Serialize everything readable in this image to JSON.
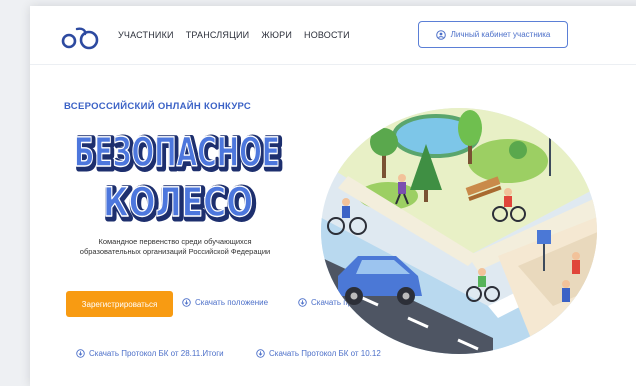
{
  "header": {
    "nav": [
      "УЧАСТНИКИ",
      "ТРАНСЛЯЦИИ",
      "ЖЮРИ",
      "НОВОСТИ"
    ],
    "account_button": "Личный кабинет участника"
  },
  "hero": {
    "eyebrow": "ВСЕРОССИЙСКИЙ ОНЛАЙН КОНКУРС",
    "title_line1": "БЕЗОПАСНОЕ",
    "title_line2": "КОЛЕСО",
    "subtitle": "Командное первенство среди обучающихся образовательных организаций Российской Федерации",
    "register_button": "Зарегистрироваться"
  },
  "links": [
    "Скачать положение",
    "Скачать приказ об",
    "Скачать Протокол БК от 28.11.Итоги",
    "Скачать Протокол БК от 10.12"
  ],
  "colors": {
    "accent_blue": "#3b62c6",
    "button_orange": "#f89b12",
    "link_blue": "#4d70c9"
  },
  "icons": {
    "logo": "bicycle-logo",
    "account": "user-icon",
    "link": "download-circle-icon"
  }
}
